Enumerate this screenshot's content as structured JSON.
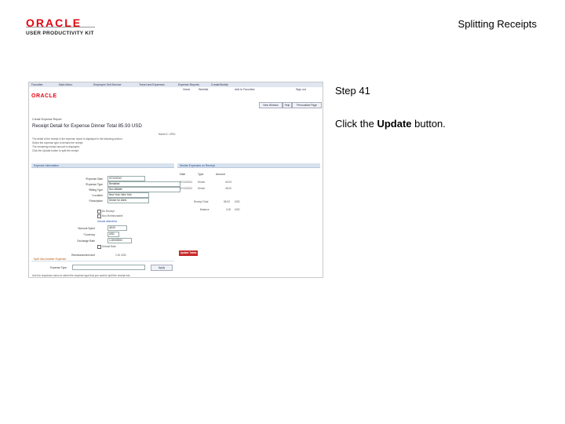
{
  "header": {
    "logo_brand": "ORACLE",
    "logo_product": "USER PRODUCTIVITY KIT",
    "doc_title": "Splitting Receipts"
  },
  "step": {
    "label": "Step 41",
    "instruction_prefix": "Click the ",
    "instruction_target": "Update",
    "instruction_suffix": " button."
  },
  "screenshot": {
    "nav_items": [
      "Favorites",
      "Main Menu",
      "Employee Self-Service",
      "Travel and Expenses",
      "Expense Reports",
      "Create/Modify"
    ],
    "sub_items": [
      "Home",
      "Worklist",
      "Add to Favorites",
      "Sign out"
    ],
    "logo": "ORACLE",
    "top_buttons": [
      "New Window",
      "Help",
      "Personalize Page"
    ],
    "section_header": "Create Expense Report",
    "page_title": "Receipt Detail for Expense Dinner  Total 85.93 USD",
    "report_name": "Name  D. UPK1",
    "intro_lines": [
      "The detail of the receipt in the expense report is displayed in the following section.",
      "Select the expense type to itemize the receipt.",
      "The remaining receipt amount is displayed.",
      "Click the Update button to split the receipt."
    ],
    "left_bar": "Expense Information",
    "right_bar": "Similar Expenses on Receipt",
    "left_fields": [
      {
        "label": "*Expense Date",
        "value": "07/12/2012"
      },
      {
        "label": "*Expense Type",
        "value": "Breakfast"
      },
      {
        "label": "*Billing Type",
        "value": "Non-billable"
      },
      {
        "label": "*Location",
        "value": "New York, New York"
      },
      {
        "label": "*Description",
        "value": "Dinner for client"
      }
    ],
    "checks": [
      "No Receipt",
      "Non-Reimbursable"
    ],
    "attendees_link": "Include attendees",
    "amount_fields": [
      {
        "label": "*Amount Spent",
        "value": "45.00"
      },
      {
        "label": "*Currency",
        "value": "USD"
      },
      {
        "label": "Exchange Rate",
        "value": "1.00000000"
      }
    ],
    "default_rate": "Default Rate",
    "reimbursement": {
      "label": "Reimbursement Amt",
      "value": "1.00   USD"
    },
    "split_bar": "Split Into Another Expense",
    "split_label": "Expense Type",
    "apply_btn": "Apply",
    "footer_note": "Use the dropdown menu to select the expense type that you want to split the receipt into.",
    "update_btn": "Update Totals",
    "right_columns": [
      "Date",
      "Type",
      "Amount"
    ],
    "right_rows": [
      {
        "date": "07/12/2012",
        "type": "Dinner",
        "amount": "40.93"
      },
      {
        "date": "07/12/2012",
        "type": "Dinner",
        "amount": "45.00"
      }
    ],
    "receipt_total": {
      "label": "Receipt Total",
      "value": "85.93",
      "currency": "USD"
    },
    "balance": {
      "label": "Balance",
      "value": "0.00",
      "currency": "USD"
    }
  }
}
